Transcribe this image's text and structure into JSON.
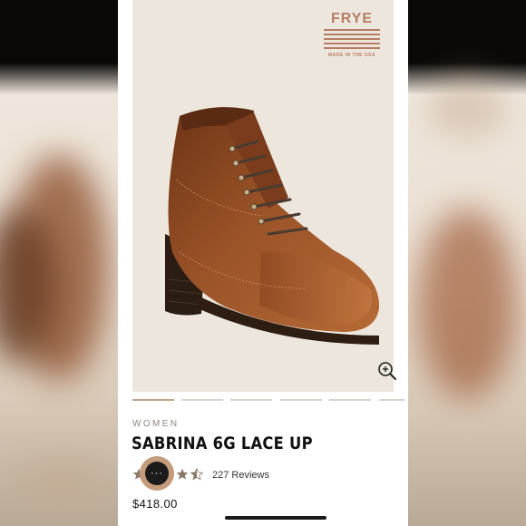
{
  "brand": {
    "name": "FRYE",
    "tagline": "MADE IN THE USA",
    "color": "#b57c64"
  },
  "product": {
    "category": "WOMEN",
    "title": "SABRINA 6G LACE UP",
    "rating_stars": 4.5,
    "reviews": "227 Reviews",
    "price": "$418.00"
  },
  "gallery": {
    "image_count": 6,
    "active_index": 0,
    "zoom_icon": "zoom-in-icon"
  },
  "chat": {
    "icon": "chat-dots-icon",
    "label": "···"
  },
  "colors": {
    "accent": "#c49c7b",
    "star": "#8a7a6a",
    "boot": "#8b4a22"
  }
}
